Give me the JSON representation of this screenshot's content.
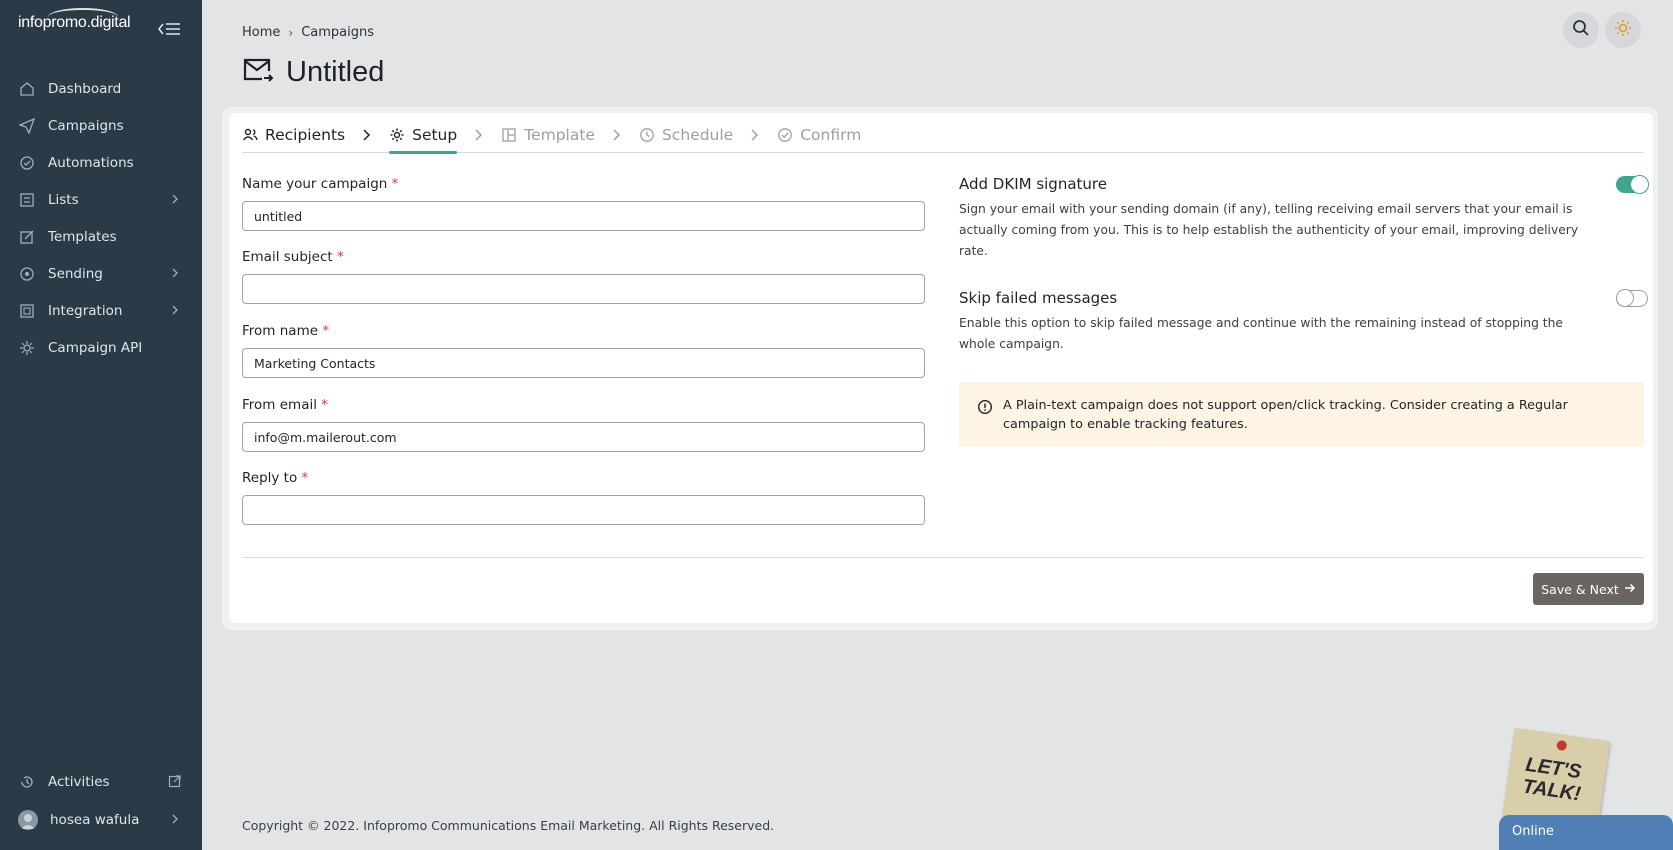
{
  "sidebar": {
    "brand": "infopromo.digital",
    "items": [
      {
        "label": "Dashboard",
        "icon": "home-icon"
      },
      {
        "label": "Campaigns",
        "icon": "send-icon"
      },
      {
        "label": "Automations",
        "icon": "automation-icon"
      },
      {
        "label": "Lists",
        "icon": "lists-icon",
        "has_submenu": true
      },
      {
        "label": "Templates",
        "icon": "templates-icon"
      },
      {
        "label": "Sending",
        "icon": "sending-icon",
        "has_submenu": true
      },
      {
        "label": "Integration",
        "icon": "integration-icon",
        "has_submenu": true
      },
      {
        "label": "Campaign API",
        "icon": "api-icon"
      }
    ],
    "bottom": {
      "activities": "Activities",
      "user": "hosea wafula"
    }
  },
  "breadcrumb": {
    "home": "Home",
    "separator": "›",
    "current": "Campaigns"
  },
  "page_title": "Untitled",
  "steps": [
    {
      "label": "Recipients",
      "icon": "users-icon",
      "state": "done"
    },
    {
      "label": "Setup",
      "icon": "gear-icon",
      "state": "active"
    },
    {
      "label": "Template",
      "icon": "layout-icon",
      "state": "pending"
    },
    {
      "label": "Schedule",
      "icon": "clock-icon",
      "state": "pending"
    },
    {
      "label": "Confirm",
      "icon": "check-circle-icon",
      "state": "pending"
    }
  ],
  "form": {
    "required_mark": "*",
    "campaign_name": {
      "label": "Name your campaign",
      "value": "untitled"
    },
    "email_subject": {
      "label": "Email subject",
      "value": ""
    },
    "from_name": {
      "label": "From name",
      "value": "Marketing Contacts"
    },
    "from_email": {
      "label": "From email",
      "value": "info@m.mailerout.com"
    },
    "reply_to": {
      "label": "Reply to",
      "value": ""
    }
  },
  "options": {
    "dkim": {
      "title": "Add DKIM signature",
      "description": "Sign your email with your sending domain (if any), telling receiving email servers that your email is actually coming from you. This is to help establish the authenticity of your email, improving delivery rate.",
      "enabled": true
    },
    "skip_failed": {
      "title": "Skip failed messages",
      "description": "Enable this option to skip failed message and continue with the remaining instead of stopping the whole campaign.",
      "enabled": false
    }
  },
  "alert": {
    "text": "A Plain-text campaign does not support open/click tracking. Consider creating a Regular campaign to enable tracking features."
  },
  "save_button": "Save & Next",
  "footer": "Copyright © 2022. Infopromo Communications Email Marketing. All Rights Reserved.",
  "chat": {
    "status": "Online",
    "sticker": "LET'S TALK!"
  },
  "colors": {
    "sidebar_bg": "#2a3a46",
    "accent": "#3fa58e",
    "alert_bg": "#fdf4e3",
    "button_bg": "#6b6560",
    "chat_bg": "#4f7fb5"
  }
}
